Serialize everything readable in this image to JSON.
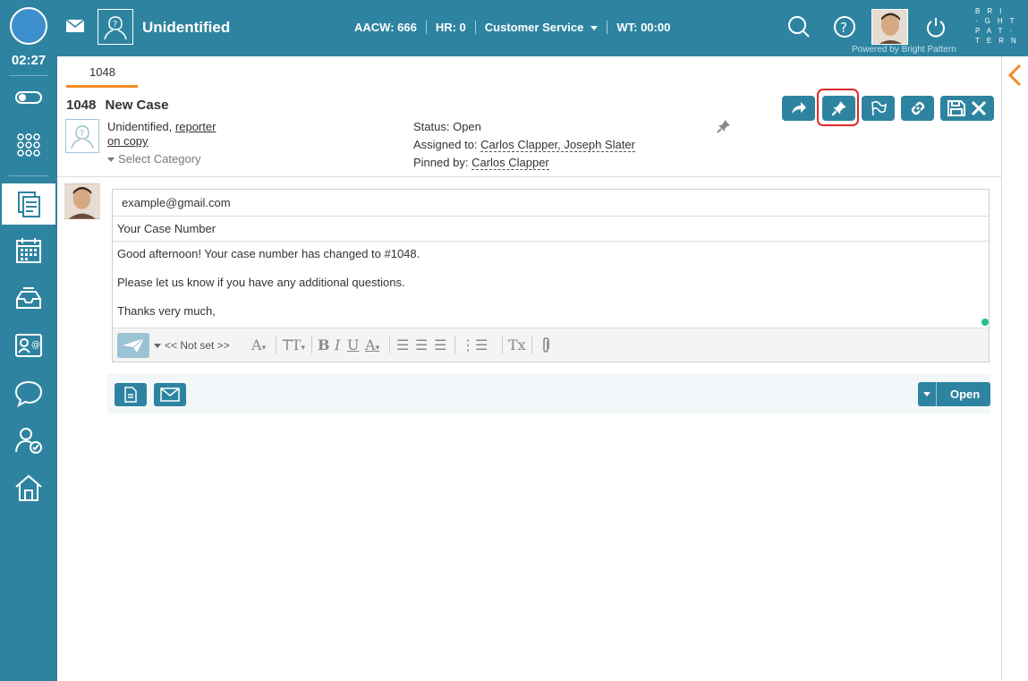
{
  "topbar": {
    "clock": "02:27",
    "agent_name": "Unidentified",
    "metrics": [
      {
        "label": "AACW: 666"
      },
      {
        "label": "HR: 0"
      },
      {
        "label": "Customer Service"
      },
      {
        "label": "WT: 00:00"
      }
    ],
    "brand_lines": [
      "BRI",
      "·GHT",
      "PAT·",
      "TERN"
    ],
    "powered_by": "Powered by Bright Pattern"
  },
  "tab": {
    "label": "1048"
  },
  "case": {
    "number": "1048",
    "title": "New Case",
    "contact_name": "Unidentified,",
    "contact_role": "reporter",
    "contact_copy": "on copy",
    "category_placeholder": "Select Category",
    "status_label": "Status:",
    "status_value": "Open",
    "assigned_label": "Assigned to:",
    "assigned_value": "Carlos Clapper, Joseph Slater",
    "pinned_label": "Pinned by:",
    "pinned_value": "Carlos Clapper"
  },
  "email": {
    "to": "example@gmail.com",
    "subject": "Your Case Number",
    "body_lines": [
      "Good afternoon! Your case number has changed to #1048.",
      "Please let us know if you have any additional questions.",
      "Thanks very much,"
    ],
    "from_selector": "<< Not set >>"
  },
  "footer": {
    "open_label": "Open"
  },
  "colors": {
    "primary": "#2e84a0",
    "accent_tab": "#f28b20",
    "highlight": "#e12a2a"
  }
}
